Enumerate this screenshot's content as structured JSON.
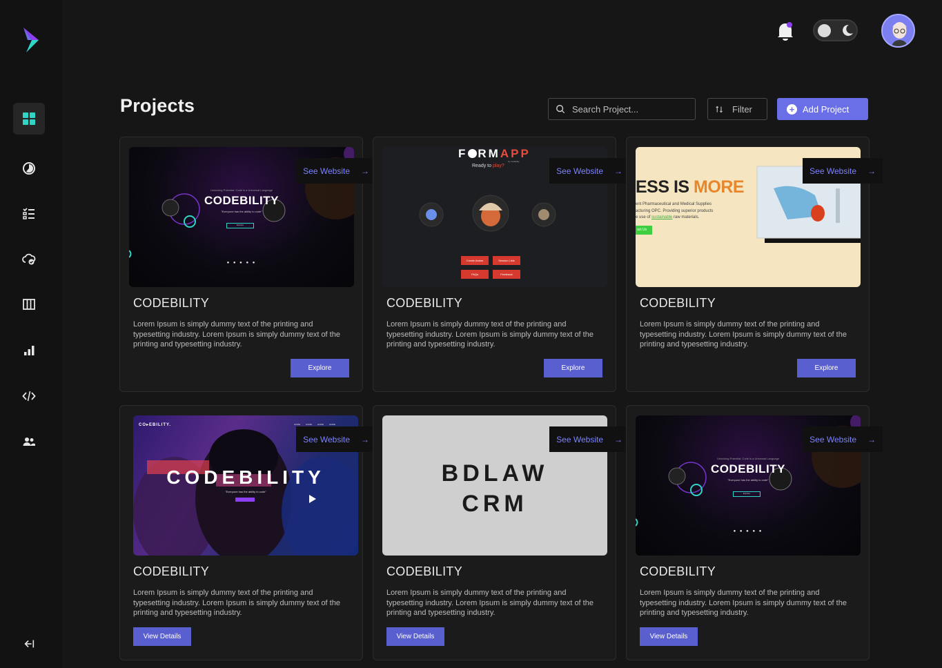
{
  "header": {
    "page_title": "Projects",
    "search_placeholder": "Search Project...",
    "filter_label": "Filter",
    "add_project_label": "Add Project"
  },
  "sidebar": {
    "items": [
      {
        "icon": "dashboard-icon",
        "active": true
      },
      {
        "icon": "pie-chart-icon"
      },
      {
        "icon": "task-list-icon"
      },
      {
        "icon": "cloud-check-icon"
      },
      {
        "icon": "columns-icon"
      },
      {
        "icon": "bar-chart-icon"
      },
      {
        "icon": "code-icon"
      },
      {
        "icon": "team-icon"
      }
    ],
    "collapse_icon": "collapse-icon"
  },
  "cards": [
    {
      "thumb": "CODEBILITY",
      "see_website": "See Website",
      "title": "CODEBILITY",
      "desc": "Lorem Ipsum is simply dummy text of the printing and typesetting industry. Lorem Ipsum is simply dummy text of the printing and typesetting industry.",
      "button": "Explore"
    },
    {
      "thumb": "FORMAPP",
      "see_website": "See Website",
      "title": "CODEBILITY",
      "desc": "Lorem Ipsum is simply dummy text of the printing and typesetting industry. Lorem Ipsum is simply dummy text of the printing and typesetting industry.",
      "button": "Explore"
    },
    {
      "thumb": "ESS IS MORE",
      "see_website": "See Website",
      "title": "CODEBILITY",
      "desc": "Lorem Ipsum is simply dummy text of the printing and typesetting industry. Lorem Ipsum is simply dummy text of the printing and typesetting industry.",
      "button": "Explore"
    },
    {
      "thumb": "CODEBILITY",
      "see_website": "See Website",
      "title": "CODEBILITY",
      "desc": "Lorem Ipsum is simply dummy text of the printing and typesetting industry. Lorem Ipsum is simply dummy text of the printing and typesetting industry.",
      "button": "View Details"
    },
    {
      "thumb": "BDLAW CRM",
      "see_website": "See Website",
      "title": "CODEBILITY",
      "desc": "Lorem Ipsum is simply dummy text of the printing and typesetting industry. Lorem Ipsum is simply dummy text of the printing and typesetting industry.",
      "button": "View Details"
    },
    {
      "thumb": "CODEBILITY",
      "see_website": "See Website",
      "title": "CODEBILITY",
      "desc": "Lorem Ipsum is simply dummy text of the printing and typesetting industry. Lorem Ipsum is simply dummy text of the printing and typesetting industry.",
      "button": "View Details"
    }
  ],
  "thumb_text": {
    "codebility_tagline": "Unlocking Potential: Code is a Universal Language",
    "codebility_quote": "\"Everyone has the ability to code\"",
    "codebility_cta": "Explore",
    "formapp_logo_a": "F",
    "formapp_logo_b": "RM",
    "formapp_logo_c": "APP",
    "formapp_sub": "by codebility",
    "formapp_ready": "Ready to",
    "formapp_play": "play?",
    "formapp_btn1": "Create Avatar",
    "formapp_btn2": "Session Lists",
    "formapp_btn3": "FAQs",
    "formapp_btn4": "Feedback",
    "lab_big_a": "ESS IS ",
    "lab_big_b": "MORE",
    "lab_line1": "ent Pharmaceutical and Medical Supplies",
    "lab_line2": "acturing OPC. Providing superior products",
    "lab_line3a": "e use of ",
    "lab_line3b": "sustainable",
    "lab_line3c": " raw materials.",
    "lab_cta": "act Us",
    "people_brand": "CO▸EBILITY.",
    "people_big": "CODEBILITY",
    "people_quote": "\"Everyone has the ability to code\"",
    "people_nav1": "HOME",
    "people_nav2": "HOME",
    "people_nav3": "HOME",
    "people_nav4": "HOME",
    "bdlaw_line1": "BDLAW",
    "bdlaw_line2": "CRM"
  },
  "colors": {
    "accent": "#6a6fe8",
    "button": "#5a5fd0",
    "link": "#7d82ff",
    "bg": "#161616",
    "card": "#1b1b1b"
  }
}
